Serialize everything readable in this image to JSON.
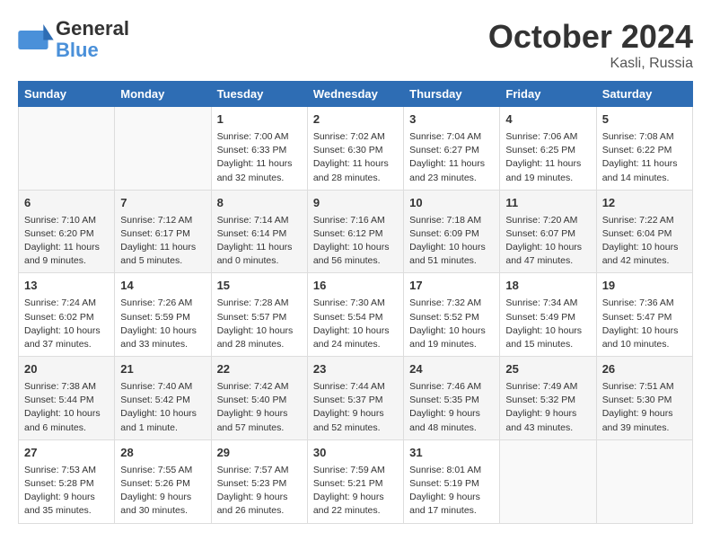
{
  "header": {
    "logo_line1": "General",
    "logo_line2": "Blue",
    "month": "October 2024",
    "location": "Kasli, Russia"
  },
  "columns": [
    "Sunday",
    "Monday",
    "Tuesday",
    "Wednesday",
    "Thursday",
    "Friday",
    "Saturday"
  ],
  "weeks": [
    [
      {
        "day": "",
        "content": ""
      },
      {
        "day": "",
        "content": ""
      },
      {
        "day": "1",
        "content": "Sunrise: 7:00 AM\nSunset: 6:33 PM\nDaylight: 11 hours and 32 minutes."
      },
      {
        "day": "2",
        "content": "Sunrise: 7:02 AM\nSunset: 6:30 PM\nDaylight: 11 hours and 28 minutes."
      },
      {
        "day": "3",
        "content": "Sunrise: 7:04 AM\nSunset: 6:27 PM\nDaylight: 11 hours and 23 minutes."
      },
      {
        "day": "4",
        "content": "Sunrise: 7:06 AM\nSunset: 6:25 PM\nDaylight: 11 hours and 19 minutes."
      },
      {
        "day": "5",
        "content": "Sunrise: 7:08 AM\nSunset: 6:22 PM\nDaylight: 11 hours and 14 minutes."
      }
    ],
    [
      {
        "day": "6",
        "content": "Sunrise: 7:10 AM\nSunset: 6:20 PM\nDaylight: 11 hours and 9 minutes."
      },
      {
        "day": "7",
        "content": "Sunrise: 7:12 AM\nSunset: 6:17 PM\nDaylight: 11 hours and 5 minutes."
      },
      {
        "day": "8",
        "content": "Sunrise: 7:14 AM\nSunset: 6:14 PM\nDaylight: 11 hours and 0 minutes."
      },
      {
        "day": "9",
        "content": "Sunrise: 7:16 AM\nSunset: 6:12 PM\nDaylight: 10 hours and 56 minutes."
      },
      {
        "day": "10",
        "content": "Sunrise: 7:18 AM\nSunset: 6:09 PM\nDaylight: 10 hours and 51 minutes."
      },
      {
        "day": "11",
        "content": "Sunrise: 7:20 AM\nSunset: 6:07 PM\nDaylight: 10 hours and 47 minutes."
      },
      {
        "day": "12",
        "content": "Sunrise: 7:22 AM\nSunset: 6:04 PM\nDaylight: 10 hours and 42 minutes."
      }
    ],
    [
      {
        "day": "13",
        "content": "Sunrise: 7:24 AM\nSunset: 6:02 PM\nDaylight: 10 hours and 37 minutes."
      },
      {
        "day": "14",
        "content": "Sunrise: 7:26 AM\nSunset: 5:59 PM\nDaylight: 10 hours and 33 minutes."
      },
      {
        "day": "15",
        "content": "Sunrise: 7:28 AM\nSunset: 5:57 PM\nDaylight: 10 hours and 28 minutes."
      },
      {
        "day": "16",
        "content": "Sunrise: 7:30 AM\nSunset: 5:54 PM\nDaylight: 10 hours and 24 minutes."
      },
      {
        "day": "17",
        "content": "Sunrise: 7:32 AM\nSunset: 5:52 PM\nDaylight: 10 hours and 19 minutes."
      },
      {
        "day": "18",
        "content": "Sunrise: 7:34 AM\nSunset: 5:49 PM\nDaylight: 10 hours and 15 minutes."
      },
      {
        "day": "19",
        "content": "Sunrise: 7:36 AM\nSunset: 5:47 PM\nDaylight: 10 hours and 10 minutes."
      }
    ],
    [
      {
        "day": "20",
        "content": "Sunrise: 7:38 AM\nSunset: 5:44 PM\nDaylight: 10 hours and 6 minutes."
      },
      {
        "day": "21",
        "content": "Sunrise: 7:40 AM\nSunset: 5:42 PM\nDaylight: 10 hours and 1 minute."
      },
      {
        "day": "22",
        "content": "Sunrise: 7:42 AM\nSunset: 5:40 PM\nDaylight: 9 hours and 57 minutes."
      },
      {
        "day": "23",
        "content": "Sunrise: 7:44 AM\nSunset: 5:37 PM\nDaylight: 9 hours and 52 minutes."
      },
      {
        "day": "24",
        "content": "Sunrise: 7:46 AM\nSunset: 5:35 PM\nDaylight: 9 hours and 48 minutes."
      },
      {
        "day": "25",
        "content": "Sunrise: 7:49 AM\nSunset: 5:32 PM\nDaylight: 9 hours and 43 minutes."
      },
      {
        "day": "26",
        "content": "Sunrise: 7:51 AM\nSunset: 5:30 PM\nDaylight: 9 hours and 39 minutes."
      }
    ],
    [
      {
        "day": "27",
        "content": "Sunrise: 7:53 AM\nSunset: 5:28 PM\nDaylight: 9 hours and 35 minutes."
      },
      {
        "day": "28",
        "content": "Sunrise: 7:55 AM\nSunset: 5:26 PM\nDaylight: 9 hours and 30 minutes."
      },
      {
        "day": "29",
        "content": "Sunrise: 7:57 AM\nSunset: 5:23 PM\nDaylight: 9 hours and 26 minutes."
      },
      {
        "day": "30",
        "content": "Sunrise: 7:59 AM\nSunset: 5:21 PM\nDaylight: 9 hours and 22 minutes."
      },
      {
        "day": "31",
        "content": "Sunrise: 8:01 AM\nSunset: 5:19 PM\nDaylight: 9 hours and 17 minutes."
      },
      {
        "day": "",
        "content": ""
      },
      {
        "day": "",
        "content": ""
      }
    ]
  ]
}
